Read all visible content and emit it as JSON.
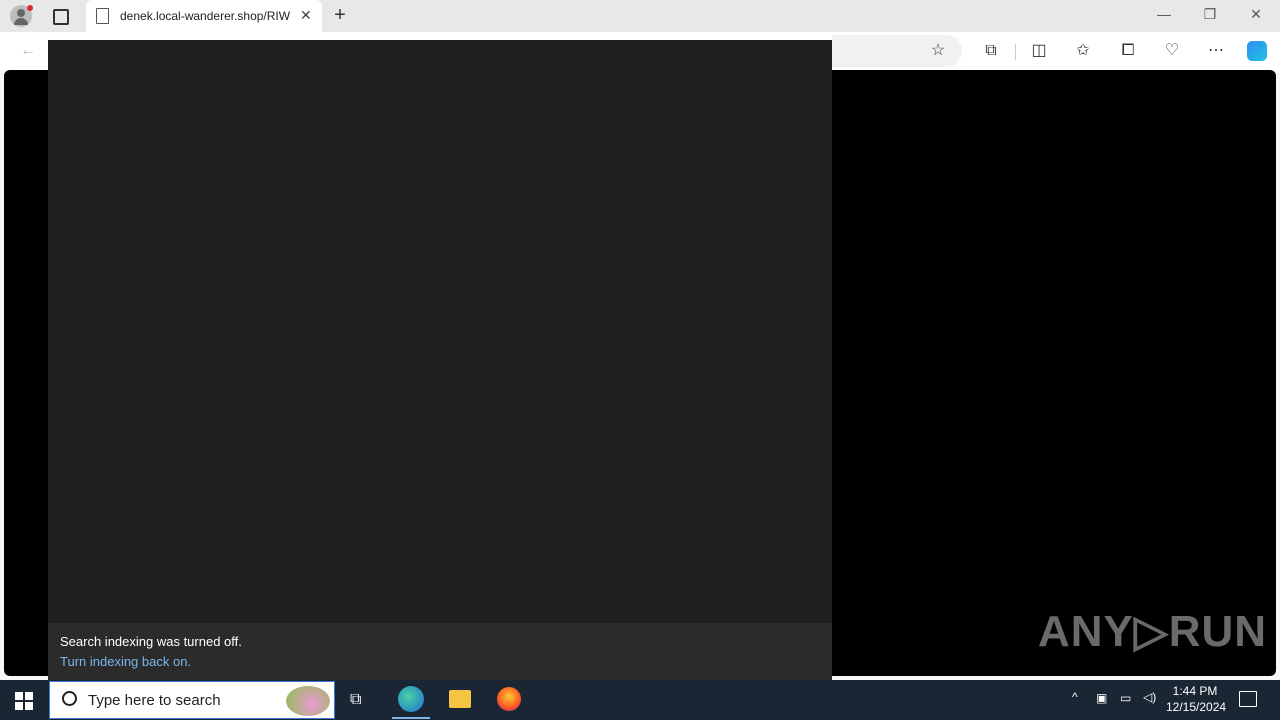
{
  "browser": {
    "tab_title": "denek.local-wanderer.shop/RIW",
    "tab_close": "✕",
    "new_tab": "+",
    "window_controls": {
      "minimize": "—",
      "restore": "❐",
      "close": "✕"
    }
  },
  "search_panel": {
    "notice_text": "Search indexing was turned off.",
    "notice_link": "Turn indexing back on."
  },
  "watermark": {
    "text": "ANY▷RUN"
  },
  "taskbar": {
    "search_placeholder": "Type here to search",
    "clock_time": "1:44 PM",
    "clock_date": "12/15/2024"
  },
  "icons": {
    "profile": "person-icon",
    "tab_actions": "tab-actions-icon",
    "back": "back-icon",
    "favorite": "star-icon",
    "extensions": "puzzle-icon",
    "split": "split-screen-icon",
    "favorites": "favorites-icon",
    "collections": "collections-icon",
    "performance": "heart-pulse-icon",
    "more": "more-icon",
    "copilot": "copilot-icon"
  }
}
